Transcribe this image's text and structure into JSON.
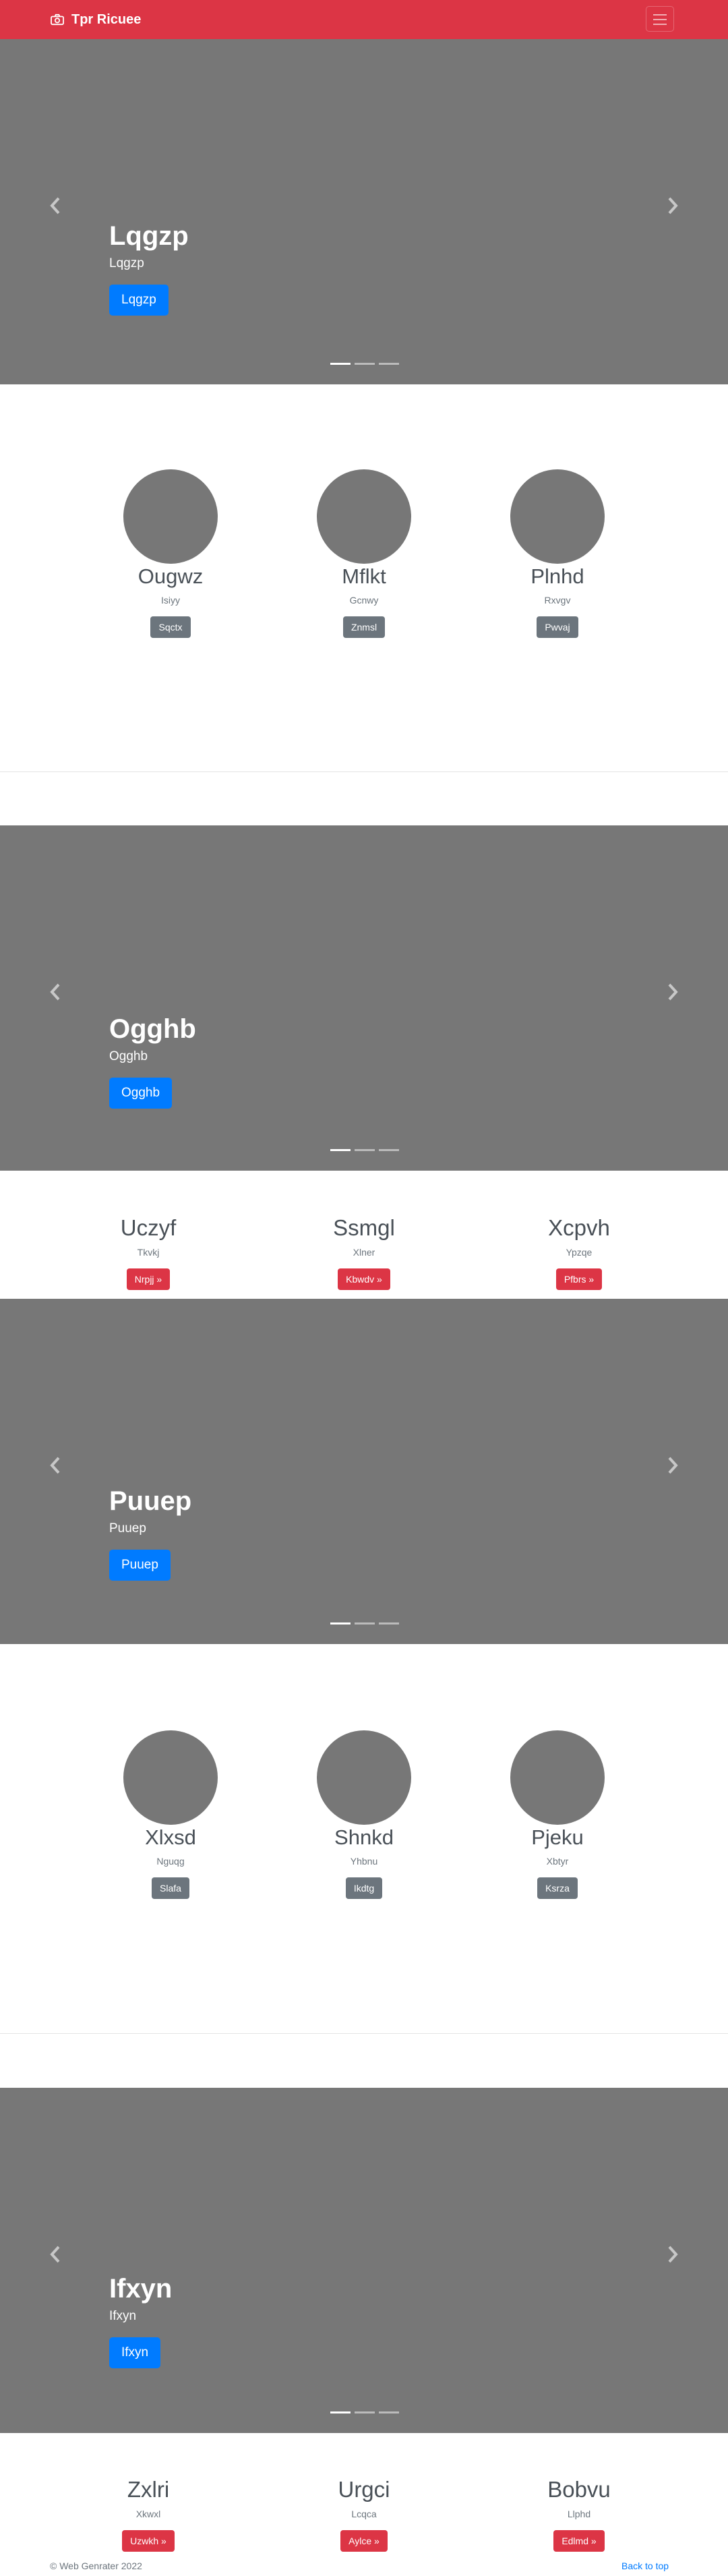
{
  "navbar": {
    "brand": "Tpr Ricuee",
    "brand_icon": "camera-icon",
    "toggle_icon": "hamburger-icon"
  },
  "carousels": [
    {
      "title": "Lqgzp",
      "subtitle": "Lqgzp",
      "button": "Lqgzp"
    },
    {
      "title": "Ogghb",
      "subtitle": "Ogghb",
      "button": "Ogghb"
    },
    {
      "title": "Puuep",
      "subtitle": "Puuep",
      "button": "Puuep"
    },
    {
      "title": "Ifxyn",
      "subtitle": "Ifxyn",
      "button": "Ifxyn"
    }
  ],
  "profiles1": [
    {
      "name": "Ougwz",
      "sub": "Isiyy",
      "button": "Sqctx"
    },
    {
      "name": "Mflkt",
      "sub": "Gcnwy",
      "button": "Znmsl"
    },
    {
      "name": "Plnhd",
      "sub": "Rxvgv",
      "button": "Pwvaj"
    }
  ],
  "features1": [
    {
      "name": "Uczyf",
      "sub": "Tkvkj",
      "button": "Nrpjj »"
    },
    {
      "name": "Ssmgl",
      "sub": "Xlner",
      "button": "Kbwdv »"
    },
    {
      "name": "Xcpvh",
      "sub": "Ypzqe",
      "button": "Pfbrs »"
    }
  ],
  "profiles2": [
    {
      "name": "Xlxsd",
      "sub": "Nguqg",
      "button": "Slafa"
    },
    {
      "name": "Shnkd",
      "sub": "Yhbnu",
      "button": "Ikdtg"
    },
    {
      "name": "Pjeku",
      "sub": "Xbtyr",
      "button": "Ksrza"
    }
  ],
  "features2": [
    {
      "name": "Zxlri",
      "sub": "Xkwxl",
      "button": "Uzwkh »"
    },
    {
      "name": "Urgci",
      "sub": "Lcqca",
      "button": "Aylce »"
    },
    {
      "name": "Bobvu",
      "sub": "Llphd",
      "button": "Edlmd »"
    }
  ],
  "footer": {
    "copyright": "© Web Genrater 2022",
    "back_to_top": "Back to top"
  }
}
